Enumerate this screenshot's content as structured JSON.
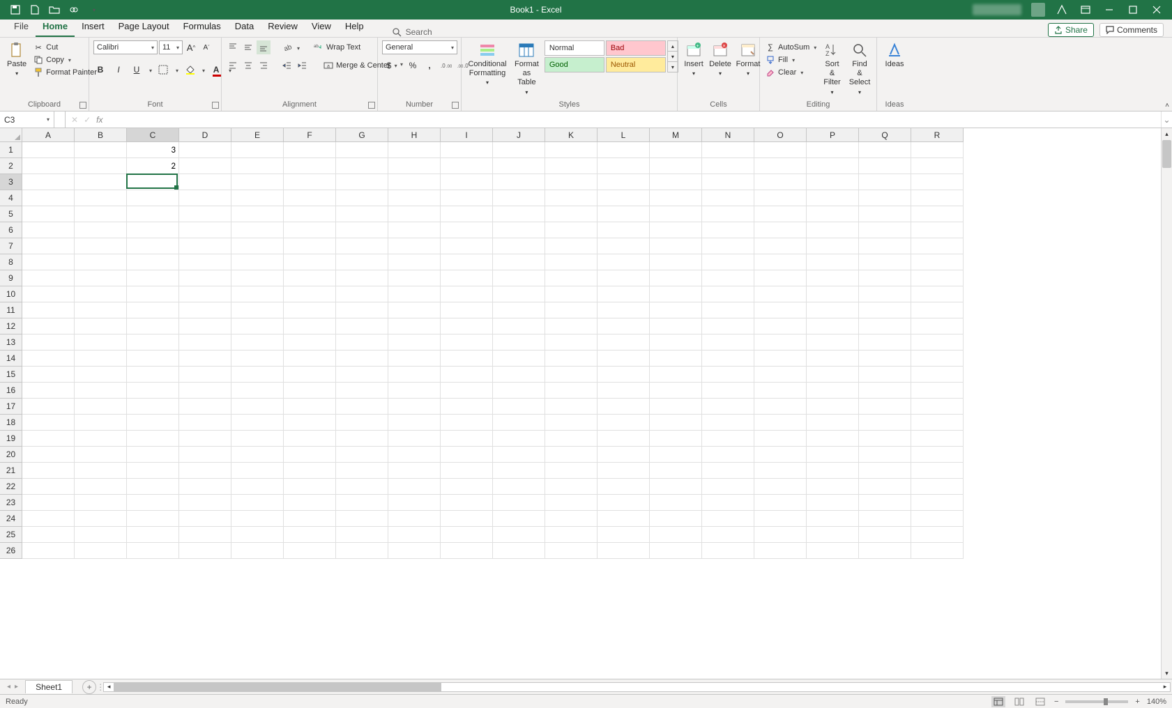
{
  "title": "Book1 - Excel",
  "tabs": [
    "File",
    "Home",
    "Insert",
    "Page Layout",
    "Formulas",
    "Data",
    "Review",
    "View",
    "Help"
  ],
  "active_tab": "Home",
  "search_placeholder": "Search",
  "share_label": "Share",
  "comments_label": "Comments",
  "ribbon": {
    "clipboard": {
      "paste": "Paste",
      "cut": "Cut",
      "copy": "Copy",
      "format_painter": "Format Painter",
      "label": "Clipboard"
    },
    "font": {
      "name": "Calibri",
      "size": "11",
      "label": "Font"
    },
    "alignment": {
      "wrap": "Wrap Text",
      "merge": "Merge & Center",
      "label": "Alignment"
    },
    "number": {
      "format": "General",
      "label": "Number"
    },
    "styles": {
      "conditional": "Conditional Formatting",
      "table": "Format as Table",
      "s_normal": "Normal",
      "s_bad": "Bad",
      "s_good": "Good",
      "s_neutral": "Neutral",
      "label": "Styles"
    },
    "cells": {
      "insert": "Insert",
      "delete": "Delete",
      "format": "Format",
      "label": "Cells"
    },
    "editing": {
      "autosum": "AutoSum",
      "fill": "Fill",
      "clear": "Clear",
      "sort": "Sort & Filter",
      "find": "Find & Select",
      "label": "Editing"
    },
    "ideas": {
      "ideas": "Ideas",
      "label": "Ideas"
    }
  },
  "namebox": "C3",
  "formula_value": "",
  "columns": [
    "A",
    "B",
    "C",
    "D",
    "E",
    "F",
    "G",
    "H",
    "I",
    "J",
    "K",
    "L",
    "M",
    "N",
    "O",
    "P",
    "Q",
    "R"
  ],
  "rows": 26,
  "active": {
    "col": "C",
    "row": 3,
    "colIndex": 2
  },
  "cells": {
    "C1": "3",
    "C2": "2"
  },
  "sheet_tab": "Sheet1",
  "status": "Ready",
  "zoom": "140%"
}
